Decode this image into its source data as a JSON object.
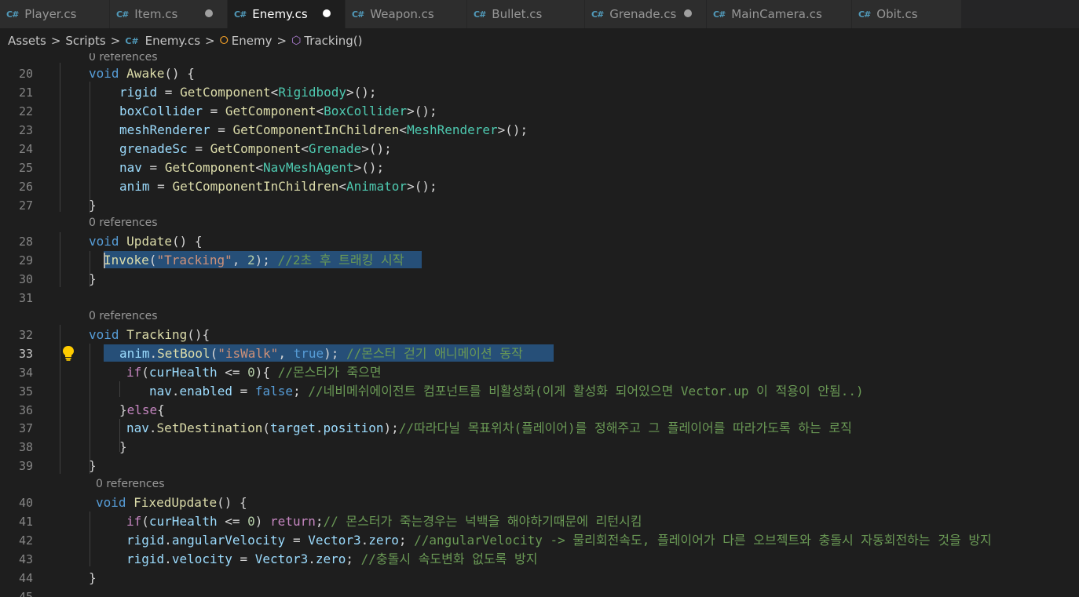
{
  "tabs": [
    {
      "label": "Player.cs",
      "icon": "csharp-icon",
      "modified": false,
      "active": false
    },
    {
      "label": "Item.cs",
      "icon": "csharp-icon",
      "modified": true,
      "active": false
    },
    {
      "label": "Enemy.cs",
      "icon": "csharp-icon",
      "modified": true,
      "active": true
    },
    {
      "label": "Weapon.cs",
      "icon": "csharp-icon",
      "modified": false,
      "active": false
    },
    {
      "label": "Bullet.cs",
      "icon": "csharp-icon",
      "modified": false,
      "active": false
    },
    {
      "label": "Grenade.cs",
      "icon": "csharp-icon",
      "modified": true,
      "active": false
    },
    {
      "label": "MainCamera.cs",
      "icon": "csharp-icon",
      "modified": false,
      "active": false
    },
    {
      "label": "Obit.cs",
      "icon": "csharp-icon",
      "modified": false,
      "active": false
    }
  ],
  "breadcrumb": {
    "items": [
      "Assets",
      "Scripts",
      "Enemy.cs",
      "Enemy",
      "Tracking()"
    ],
    "separator": ">"
  },
  "editor": {
    "references_label": "0 references",
    "lines": [
      {
        "number": "20",
        "tokens": [
          [
            "kw",
            "void"
          ],
          [
            "pl",
            " "
          ],
          [
            "fn",
            "Awake"
          ],
          [
            "pl",
            "() {"
          ]
        ]
      },
      {
        "number": "21",
        "tokens": [
          [
            "id",
            "rigid"
          ],
          [
            "pl",
            " = "
          ],
          [
            "fn",
            "GetComponent"
          ],
          [
            "pl",
            "<"
          ],
          [
            "ty",
            "Rigidbody"
          ],
          [
            "pl",
            ">();"
          ]
        ]
      },
      {
        "number": "22",
        "tokens": [
          [
            "id",
            "boxCollider"
          ],
          [
            "pl",
            " = "
          ],
          [
            "fn",
            "GetComponent"
          ],
          [
            "pl",
            "<"
          ],
          [
            "ty",
            "BoxCollider"
          ],
          [
            "pl",
            ">();"
          ]
        ]
      },
      {
        "number": "23",
        "tokens": [
          [
            "id",
            "meshRenderer"
          ],
          [
            "pl",
            " = "
          ],
          [
            "fn",
            "GetComponentInChildren"
          ],
          [
            "pl",
            "<"
          ],
          [
            "ty",
            "MeshRenderer"
          ],
          [
            "pl",
            ">();"
          ]
        ]
      },
      {
        "number": "24",
        "tokens": [
          [
            "id",
            "grenadeSc"
          ],
          [
            "pl",
            " = "
          ],
          [
            "fn",
            "GetComponent"
          ],
          [
            "pl",
            "<"
          ],
          [
            "ty",
            "Grenade"
          ],
          [
            "pl",
            ">();"
          ]
        ]
      },
      {
        "number": "25",
        "tokens": [
          [
            "id",
            "nav"
          ],
          [
            "pl",
            " = "
          ],
          [
            "fn",
            "GetComponent"
          ],
          [
            "pl",
            "<"
          ],
          [
            "ty",
            "NavMeshAgent"
          ],
          [
            "pl",
            ">();"
          ]
        ]
      },
      {
        "number": "26",
        "tokens": [
          [
            "id",
            "anim"
          ],
          [
            "pl",
            " = "
          ],
          [
            "fn",
            "GetComponentInChildren"
          ],
          [
            "pl",
            "<"
          ],
          [
            "ty",
            "Animator"
          ],
          [
            "pl",
            ">();"
          ]
        ]
      },
      {
        "number": "27",
        "tokens": [
          [
            "pl",
            "}"
          ]
        ]
      },
      {
        "number": "28",
        "tokens": [
          [
            "kw",
            "void"
          ],
          [
            "pl",
            " "
          ],
          [
            "fn",
            "Update"
          ],
          [
            "pl",
            "() {"
          ]
        ]
      },
      {
        "number": "29",
        "tokens": [
          [
            "fn",
            "Invoke"
          ],
          [
            "pl",
            "("
          ],
          [
            "st",
            "\"Tracking\""
          ],
          [
            "pl",
            ", "
          ],
          [
            "nm",
            "2"
          ],
          [
            "pl",
            "); "
          ],
          [
            "cm",
            "//2초 후 트래킹 시작"
          ]
        ]
      },
      {
        "number": "30",
        "tokens": [
          [
            "pl",
            "}"
          ]
        ]
      },
      {
        "number": "31",
        "tokens": []
      },
      {
        "number": "32",
        "tokens": [
          [
            "kw",
            "void"
          ],
          [
            "pl",
            " "
          ],
          [
            "fn",
            "Tracking"
          ],
          [
            "pl",
            "(){"
          ]
        ]
      },
      {
        "number": "33",
        "tokens": [
          [
            "id",
            "anim"
          ],
          [
            "pl",
            "."
          ],
          [
            "fn",
            "SetBool"
          ],
          [
            "pl",
            "("
          ],
          [
            "st",
            "\"isWalk\""
          ],
          [
            "pl",
            ", "
          ],
          [
            "kw",
            "true"
          ],
          [
            "pl",
            "); "
          ],
          [
            "cm",
            "//몬스터 걷기 애니메이션 동작"
          ]
        ]
      },
      {
        "number": "34",
        "tokens": [
          [
            "ct",
            "if"
          ],
          [
            "pl",
            "("
          ],
          [
            "id",
            "curHealth"
          ],
          [
            "pl",
            " <= "
          ],
          [
            "nm",
            "0"
          ],
          [
            "pl",
            "){ "
          ],
          [
            "cm",
            "//몬스터가 죽으면"
          ]
        ]
      },
      {
        "number": "35",
        "tokens": [
          [
            "id",
            "nav"
          ],
          [
            "pl",
            "."
          ],
          [
            "id",
            "enabled"
          ],
          [
            "pl",
            " = "
          ],
          [
            "kw",
            "false"
          ],
          [
            "pl",
            "; "
          ],
          [
            "cm",
            "//네비메쉬에이전트 컴포넌트를 비활성화(이게 활성화 되어있으면 Vector.up 이 적용이 안됨..)"
          ]
        ]
      },
      {
        "number": "36",
        "tokens": [
          [
            "pl",
            "}"
          ],
          [
            "ct",
            "else"
          ],
          [
            "pl",
            "{"
          ]
        ]
      },
      {
        "number": "37",
        "tokens": [
          [
            "id",
            "nav"
          ],
          [
            "pl",
            "."
          ],
          [
            "fn",
            "SetDestination"
          ],
          [
            "pl",
            "("
          ],
          [
            "id",
            "target"
          ],
          [
            "pl",
            "."
          ],
          [
            "id",
            "position"
          ],
          [
            "pl",
            ");"
          ],
          [
            "cm",
            "//따라다닐 목표위차(플레이어)를 정해주고 그 플레이어를 따라가도록 하는 로직"
          ]
        ]
      },
      {
        "number": "38",
        "tokens": [
          [
            "pl",
            "}"
          ]
        ]
      },
      {
        "number": "39",
        "tokens": [
          [
            "pl",
            "}"
          ]
        ]
      },
      {
        "number": "40",
        "tokens": [
          [
            "kw",
            "void"
          ],
          [
            "pl",
            " "
          ],
          [
            "fn",
            "FixedUpdate"
          ],
          [
            "pl",
            "() {"
          ]
        ]
      },
      {
        "number": "41",
        "tokens": [
          [
            "ct",
            "if"
          ],
          [
            "pl",
            "("
          ],
          [
            "id",
            "curHealth"
          ],
          [
            "pl",
            " <= "
          ],
          [
            "nm",
            "0"
          ],
          [
            "pl",
            ") "
          ],
          [
            "ct",
            "return"
          ],
          [
            "pl",
            ";"
          ],
          [
            "cm",
            "// 몬스터가 죽는경우는 넉백을 해야하기때문에 리턴시킴"
          ]
        ]
      },
      {
        "number": "42",
        "tokens": [
          [
            "id",
            "rigid"
          ],
          [
            "pl",
            "."
          ],
          [
            "id",
            "angularVelocity"
          ],
          [
            "pl",
            " = "
          ],
          [
            "id",
            "Vector3"
          ],
          [
            "pl",
            "."
          ],
          [
            "id",
            "zero"
          ],
          [
            "pl",
            "; "
          ],
          [
            "cm",
            "//angularVelocity -> 물리회전속도, 플레이어가 다른 오브젝트와 충돌시 자동회전하는 것을 방지"
          ]
        ]
      },
      {
        "number": "43",
        "tokens": [
          [
            "id",
            "rigid"
          ],
          [
            "pl",
            "."
          ],
          [
            "id",
            "velocity"
          ],
          [
            "pl",
            " = "
          ],
          [
            "id",
            "Vector3"
          ],
          [
            "pl",
            "."
          ],
          [
            "id",
            "zero"
          ],
          [
            "pl",
            "; "
          ],
          [
            "cm",
            "//충돌시 속도변화 없도록 방지"
          ]
        ]
      },
      {
        "number": "44",
        "tokens": [
          [
            "pl",
            "}"
          ]
        ]
      },
      {
        "number": "45",
        "tokens": []
      }
    ]
  },
  "colors": {
    "keyword": "#569cd6",
    "function": "#dcdcaa",
    "type": "#4ec9b0",
    "identifier": "#9cdcfe",
    "string": "#ce9178",
    "number": "#b5cea8",
    "comment": "#6a9955",
    "control": "#c586c0",
    "selection": "#264f78"
  },
  "icons": {
    "file": "csharp-icon",
    "class": "class-icon",
    "method": "method-icon",
    "lightbulb": "lightbulb-icon"
  }
}
